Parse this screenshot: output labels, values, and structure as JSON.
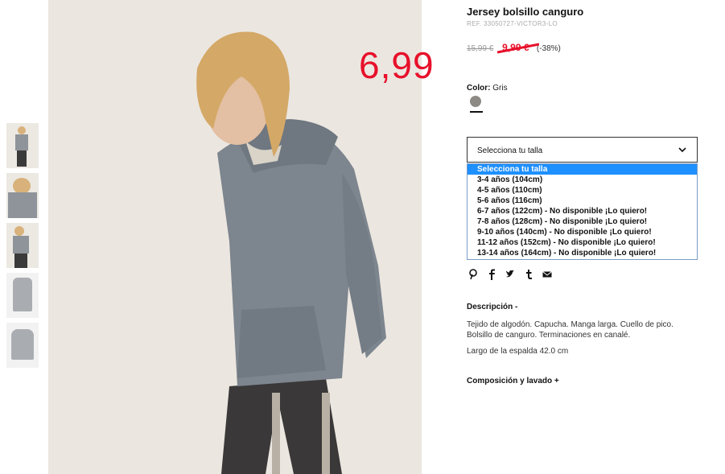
{
  "product": {
    "title": "Jersey bolsillo canguro",
    "ref": "REF. 33050727-VICTOR3-LO",
    "old_price": "15,99 €",
    "sale_price": "9,99 €",
    "discount": "(-38%)",
    "overlay_price": "6,99",
    "color_label": "Color:",
    "color_value": "Gris",
    "swatch_color": "#8d8a86",
    "accent_red": "#e8102a"
  },
  "size_select": {
    "label": "Selecciona tu talla",
    "options": [
      "Selecciona tu talla",
      "3-4 años (104cm)",
      "4-5 años (110cm)",
      "5-6 años (116cm)",
      "6-7 años (122cm) - No disponible ¡Lo quiero!",
      "7-8 años (128cm) - No disponible ¡Lo quiero!",
      "9-10 años (140cm) - No disponible ¡Lo quiero!",
      "11-12 años (152cm) - No disponible ¡Lo quiero!",
      "13-14 años (164cm) - No disponible ¡Lo quiero!"
    ],
    "highlight_color": "#1e90ff"
  },
  "share": {
    "icons": [
      "pinterest-icon",
      "facebook-icon",
      "twitter-icon",
      "tumblr-icon",
      "mail-icon"
    ],
    "glyphs": [
      "℘",
      "f",
      "🐦",
      "t",
      "✉"
    ]
  },
  "description": {
    "heading": "Descripción -",
    "text": "Tejido de algodón. Capucha. Manga larga. Cuello de pico. Bolsillo de canguro. Terminaciones en canalé.",
    "length": "Largo de la espalda 42.0 cm"
  },
  "composition": {
    "heading": "Composición y lavado +"
  }
}
